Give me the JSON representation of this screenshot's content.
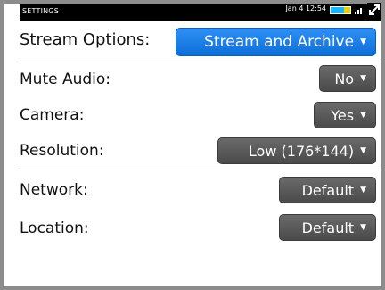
{
  "statusbar": {
    "title": "SETTINGS",
    "time": "Jan 4 12:54",
    "icons": [
      "battery-icon",
      "signal-icon",
      "expand-icon"
    ]
  },
  "settings": {
    "stream_options": {
      "label": "Stream Options:",
      "value": "Stream and Archive"
    },
    "mute_audio": {
      "label": "Mute Audio:",
      "value": "No"
    },
    "camera": {
      "label": "Camera:",
      "value": "Yes"
    },
    "resolution": {
      "label": "Resolution:",
      "value": "Low (176*144)"
    },
    "network": {
      "label": "Network:",
      "value": "Default"
    },
    "location": {
      "label": "Location:",
      "value": "Default"
    }
  },
  "dropdown_indicator": "▼",
  "colors": {
    "accent": "#1a7fe6",
    "dropdown_gray": "#555555",
    "statusbar": "#000000",
    "frame": "#8c8c8c"
  }
}
